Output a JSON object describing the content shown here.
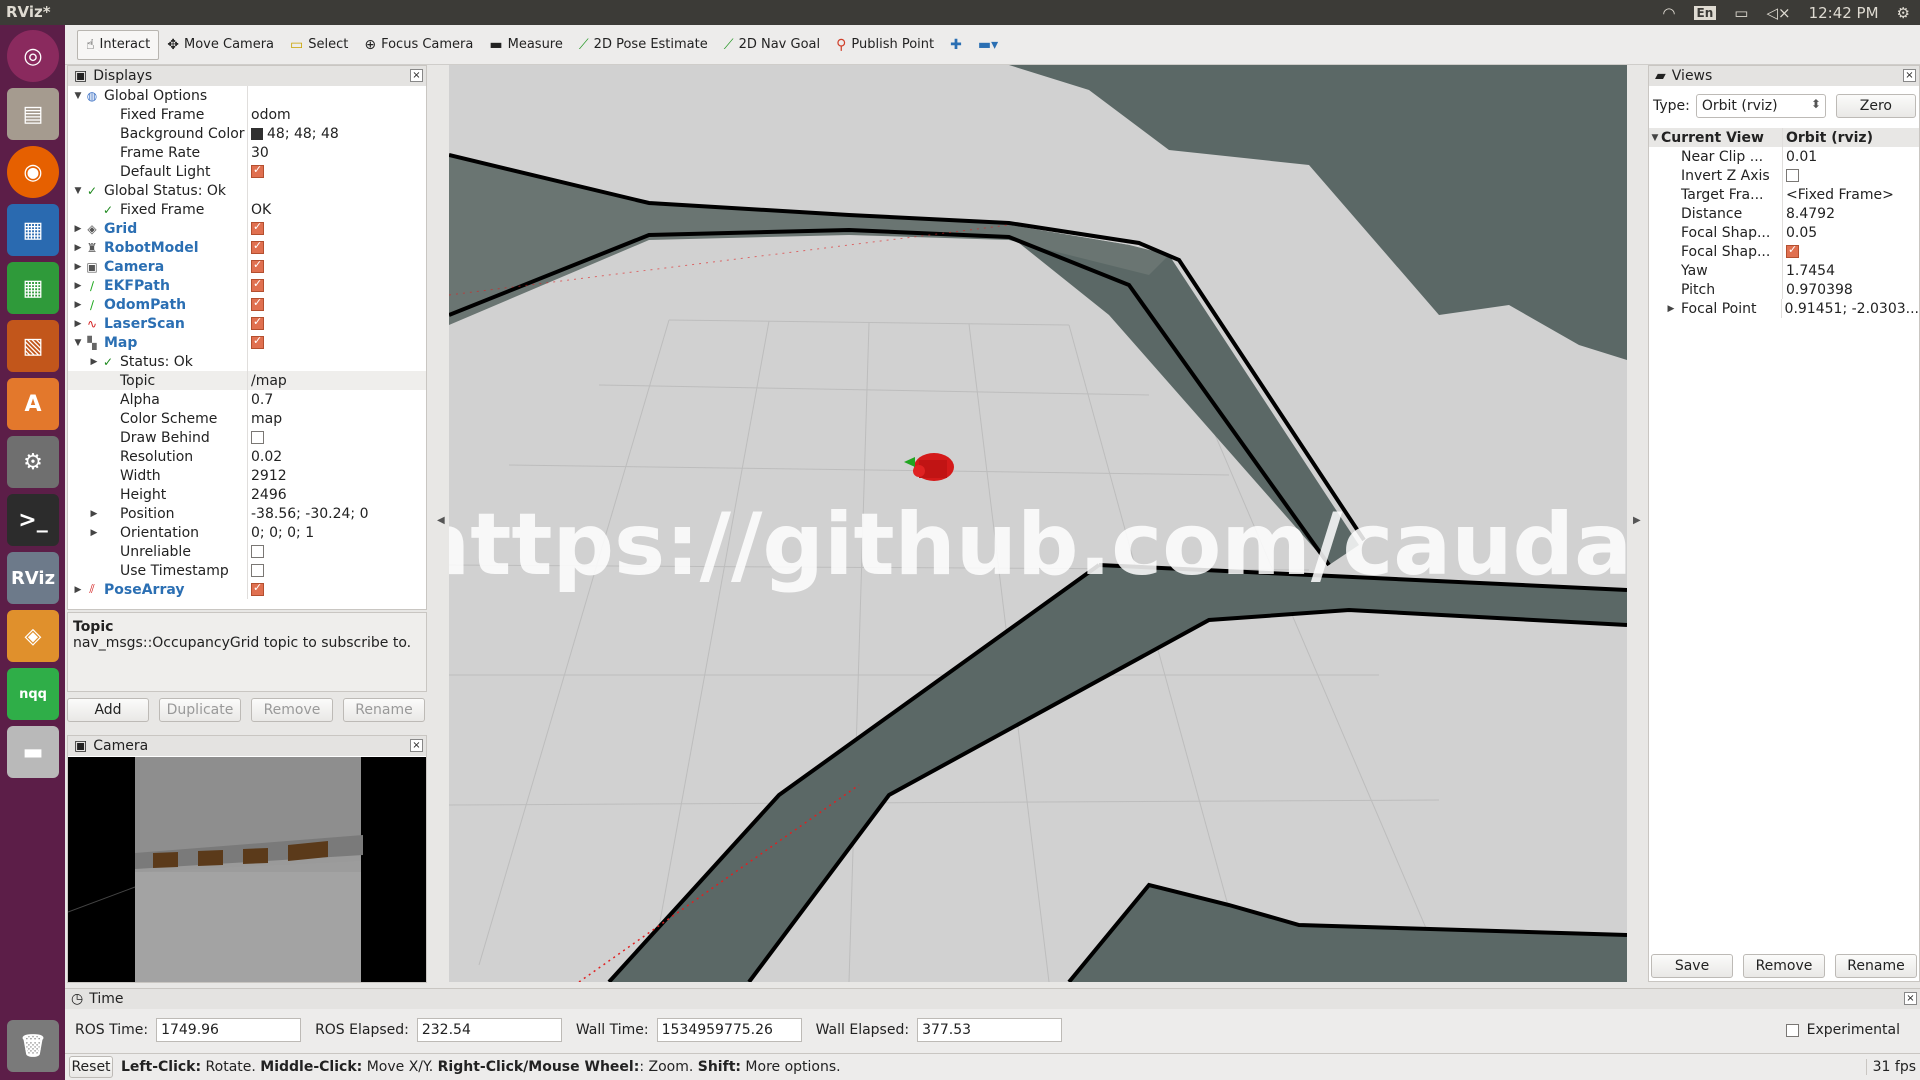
{
  "window": {
    "title": "RViz*"
  },
  "tray": {
    "lang": "En",
    "clock": "12:42 PM"
  },
  "toolbar": {
    "tools": [
      {
        "label": "Interact",
        "icon": "hand-icon"
      },
      {
        "label": "Move Camera",
        "icon": "move-camera-icon"
      },
      {
        "label": "Select",
        "icon": "select-box-icon"
      },
      {
        "label": "Focus Camera",
        "icon": "focus-icon"
      },
      {
        "label": "Measure",
        "icon": "ruler-icon"
      },
      {
        "label": "2D Pose Estimate",
        "icon": "pose-arrow-icon"
      },
      {
        "label": "2D Nav Goal",
        "icon": "nav-arrow-icon"
      },
      {
        "label": "Publish Point",
        "icon": "pin-icon"
      }
    ]
  },
  "launcher": {
    "items": [
      "ubuntu-dash-icon",
      "files-icon",
      "firefox-icon",
      "writer-icon",
      "calc-icon",
      "impress-icon",
      "software-center-icon",
      "settings-icon",
      "terminal-icon",
      "rviz-icon",
      "app-icon",
      "nqq-icon",
      "drive-icon",
      "trash-icon"
    ],
    "rviz_label": "RViz",
    "nqq_label": "nqq"
  },
  "displays": {
    "title": "Displays",
    "rows": [
      {
        "level": 0,
        "arrow": "▼",
        "icon": "globe-icon",
        "name": "Global Options",
        "value": "",
        "style": ""
      },
      {
        "level": 1,
        "arrow": "",
        "icon": "",
        "name": "Fixed Frame",
        "value": "odom",
        "style": ""
      },
      {
        "level": 1,
        "arrow": "",
        "icon": "",
        "name": "Background Color",
        "value": "48; 48; 48",
        "style": "",
        "swatch": "#303030"
      },
      {
        "level": 1,
        "arrow": "",
        "icon": "",
        "name": "Frame Rate",
        "value": "30",
        "style": ""
      },
      {
        "level": 1,
        "arrow": "",
        "icon": "",
        "name": "Default Light",
        "value": "",
        "check": true,
        "style": ""
      },
      {
        "level": 0,
        "arrow": "▼",
        "icon": "check-icon",
        "name": "Global Status: Ok",
        "value": "",
        "style": ""
      },
      {
        "level": 1,
        "arrow": "",
        "icon": "check-icon",
        "name": "Fixed Frame",
        "value": "OK",
        "style": ""
      },
      {
        "level": 0,
        "arrow": "▶",
        "icon": "grid-icon",
        "name": "Grid",
        "value": "",
        "check": true,
        "style": "blue"
      },
      {
        "level": 0,
        "arrow": "▶",
        "icon": "robot-icon",
        "name": "RobotModel",
        "value": "",
        "check": true,
        "style": "blue"
      },
      {
        "level": 0,
        "arrow": "▶",
        "icon": "camera-icon",
        "name": "Camera",
        "value": "",
        "check": true,
        "style": "blue"
      },
      {
        "level": 0,
        "arrow": "▶",
        "icon": "path-icon",
        "name": "EKFPath",
        "value": "",
        "check": true,
        "style": "blue"
      },
      {
        "level": 0,
        "arrow": "▶",
        "icon": "path-icon",
        "name": "OdomPath",
        "value": "",
        "check": true,
        "style": "blue"
      },
      {
        "level": 0,
        "arrow": "▶",
        "icon": "laser-icon",
        "name": "LaserScan",
        "value": "",
        "check": true,
        "style": "blue"
      },
      {
        "level": 0,
        "arrow": "▼",
        "icon": "map-icon",
        "name": "Map",
        "value": "",
        "check": true,
        "style": "blue"
      },
      {
        "level": 1,
        "arrow": "▶",
        "icon": "check-icon",
        "name": "Status: Ok",
        "value": "",
        "style": ""
      },
      {
        "level": 1,
        "arrow": "",
        "icon": "",
        "name": "Topic",
        "value": "/map",
        "style": "",
        "selected": true
      },
      {
        "level": 1,
        "arrow": "",
        "icon": "",
        "name": "Alpha",
        "value": "0.7",
        "style": ""
      },
      {
        "level": 1,
        "arrow": "",
        "icon": "",
        "name": "Color Scheme",
        "value": "map",
        "style": ""
      },
      {
        "level": 1,
        "arrow": "",
        "icon": "",
        "name": "Draw Behind",
        "value": "",
        "check": false,
        "style": ""
      },
      {
        "level": 1,
        "arrow": "",
        "icon": "",
        "name": "Resolution",
        "value": "0.02",
        "style": ""
      },
      {
        "level": 1,
        "arrow": "",
        "icon": "",
        "name": "Width",
        "value": "2912",
        "style": ""
      },
      {
        "level": 1,
        "arrow": "",
        "icon": "",
        "name": "Height",
        "value": "2496",
        "style": ""
      },
      {
        "level": 1,
        "arrow": "▶",
        "icon": "",
        "name": "Position",
        "value": "-38.56; -30.24; 0",
        "style": ""
      },
      {
        "level": 1,
        "arrow": "▶",
        "icon": "",
        "name": "Orientation",
        "value": "0; 0; 0; 1",
        "style": ""
      },
      {
        "level": 1,
        "arrow": "",
        "icon": "",
        "name": "Unreliable",
        "value": "",
        "check": false,
        "style": ""
      },
      {
        "level": 1,
        "arrow": "",
        "icon": "",
        "name": "Use Timestamp",
        "value": "",
        "check": false,
        "style": ""
      },
      {
        "level": 0,
        "arrow": "▶",
        "icon": "pose-array-icon",
        "name": "PoseArray",
        "value": "",
        "check": true,
        "style": "blue"
      }
    ],
    "description_title": "Topic",
    "description_text": "nav_msgs::OccupancyGrid topic to subscribe to.",
    "buttons": {
      "add": "Add",
      "duplicate": "Duplicate",
      "remove": "Remove",
      "rename": "Rename"
    }
  },
  "camera_panel": {
    "title": "Camera"
  },
  "watermark": "https://github.com/caudaz",
  "views": {
    "title": "Views",
    "type_label": "Type:",
    "type_value": "Orbit (rviz)",
    "zero_button": "Zero",
    "header_name": "Current View",
    "header_value": "Orbit (rviz)",
    "rows": [
      {
        "arrow": "",
        "name": "Near Clip ...",
        "value": "0.01"
      },
      {
        "arrow": "",
        "name": "Invert Z Axis",
        "value": "",
        "check": false
      },
      {
        "arrow": "",
        "name": "Target Fra...",
        "value": "<Fixed Frame>"
      },
      {
        "arrow": "",
        "name": "Distance",
        "value": "8.4792"
      },
      {
        "arrow": "",
        "name": "Focal Shap...",
        "value": "0.05"
      },
      {
        "arrow": "",
        "name": "Focal Shap...",
        "value": "",
        "check": true
      },
      {
        "arrow": "",
        "name": "Yaw",
        "value": "1.7454"
      },
      {
        "arrow": "",
        "name": "Pitch",
        "value": "0.970398"
      },
      {
        "arrow": "▶",
        "name": "Focal Point",
        "value": "0.91451; -2.0303..."
      }
    ],
    "buttons": {
      "save": "Save",
      "remove": "Remove",
      "rename": "Rename"
    }
  },
  "time": {
    "title": "Time",
    "ros_time_label": "ROS Time:",
    "ros_time": "1749.96",
    "ros_elapsed_label": "ROS Elapsed:",
    "ros_elapsed": "232.54",
    "wall_time_label": "Wall Time:",
    "wall_time": "1534959775.26",
    "wall_elapsed_label": "Wall Elapsed:",
    "wall_elapsed": "377.53",
    "experimental_label": "Experimental"
  },
  "status": {
    "reset": "Reset",
    "hint_1_key": "Left-Click:",
    "hint_1_val": " Rotate. ",
    "hint_2_key": "Middle-Click:",
    "hint_2_val": " Move X/Y. ",
    "hint_3_key": "Right-Click/Mouse Wheel:",
    "hint_3_val": ": Zoom. ",
    "hint_4_key": "Shift:",
    "hint_4_val": " More options.",
    "fps": "31 fps"
  }
}
